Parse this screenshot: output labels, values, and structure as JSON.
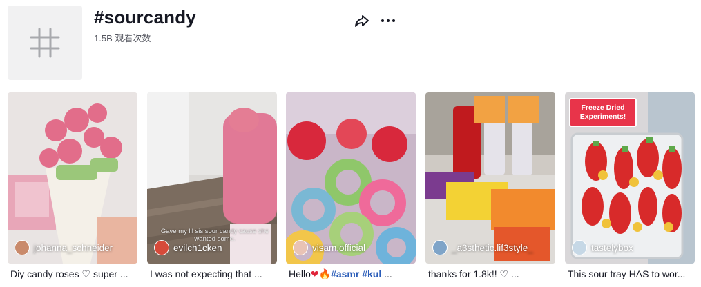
{
  "header": {
    "title": "#sourcandy",
    "views": "1.5B 观看次数"
  },
  "icons": {
    "hashtag": "hashtag-icon",
    "share": "share-icon",
    "more": "more-horizontal-icon",
    "heart_outline": "heart-outline-icon",
    "heart_red": "heart-red-emoji",
    "fire": "fire-emoji"
  },
  "videos": [
    {
      "author": "johanna_schneider",
      "caption_text": "Diy candy roses",
      "caption_after": "super ...",
      "colors": {
        "avatar": "#c98a6b"
      }
    },
    {
      "author": "evilch1cken",
      "overlay": "Gave my lil sis sour candy cause she wanted some.",
      "caption_text": "I was not expecting that ...",
      "colors": {
        "avatar": "#d64a3a"
      }
    },
    {
      "author": "visam.official",
      "caption_prefix": "Hello",
      "caption_tag1": "#asmr",
      "caption_tag2": "#kul",
      "caption_after": "...",
      "colors": {
        "avatar": "#e9c3b5"
      }
    },
    {
      "author": "_a3sthetic.lif3style_",
      "caption_text": "thanks for 1.8k!!",
      "caption_after": "...",
      "colors": {
        "avatar": "#7fa4c8"
      }
    },
    {
      "author": "tastelybox",
      "badge": "Freeze Dried Experiments!",
      "caption_text": "This sour tray HAS to wor...",
      "colors": {
        "avatar": "#c6d8e6"
      }
    }
  ]
}
